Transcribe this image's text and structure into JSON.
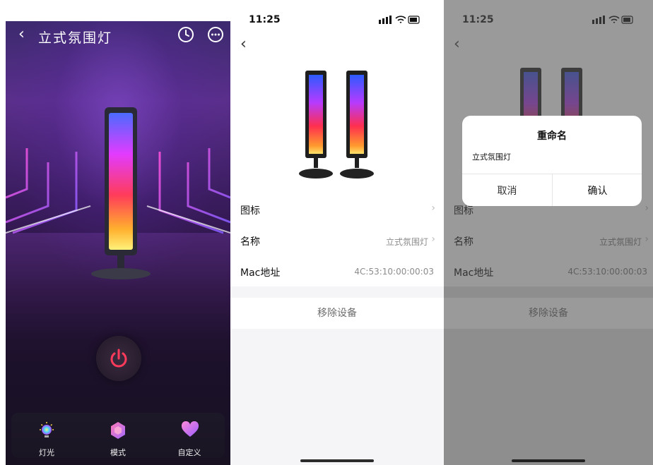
{
  "light_screen": {
    "title": "立式氛围灯",
    "nav": [
      {
        "label": "灯光",
        "icon": "light-bulb-icon"
      },
      {
        "label": "模式",
        "icon": "hexagon-mode-icon"
      },
      {
        "label": "自定义",
        "icon": "heart-icon"
      }
    ],
    "colors": {
      "power_accent": "#ff3b5c"
    }
  },
  "settings_screen": {
    "time": "11:25",
    "rows": [
      {
        "label": "图标",
        "value": ""
      },
      {
        "label": "名称",
        "value": "立式氛围灯"
      },
      {
        "label": "Mac地址",
        "value": "4C:53:10:00:00:03"
      }
    ],
    "remove_label": "移除设备"
  },
  "rename_screen": {
    "time": "11:25",
    "dialog": {
      "title": "重命名",
      "input_value": "立式氛围灯",
      "cancel_label": "取消",
      "confirm_label": "确认"
    },
    "rows": [
      {
        "label": "图标",
        "value": ""
      },
      {
        "label": "名称",
        "value": "立式氛围灯"
      },
      {
        "label": "Mac地址",
        "value": "4C:53:10:00:00:03"
      }
    ],
    "remove_label": "移除设备"
  }
}
